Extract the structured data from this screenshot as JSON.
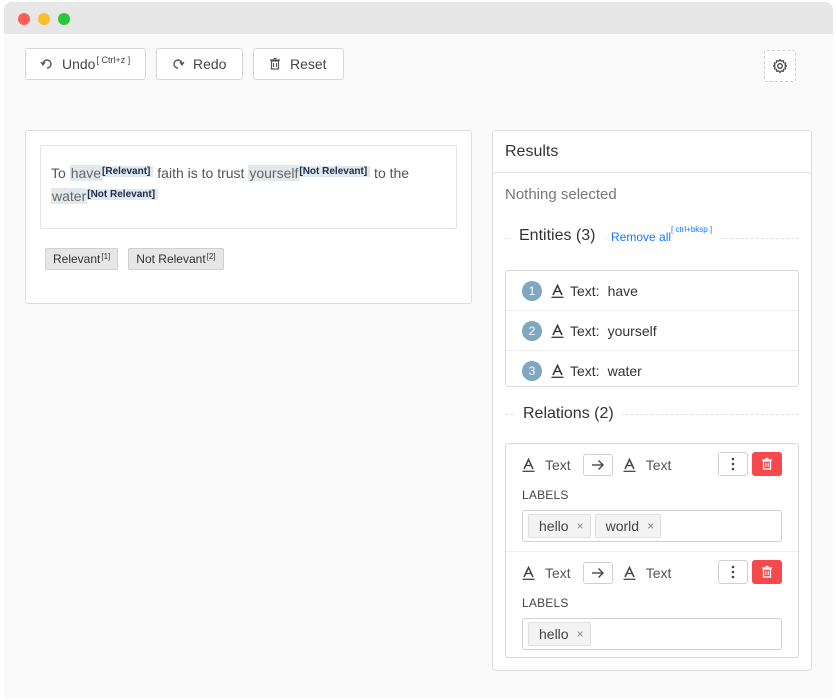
{
  "toolbar": {
    "undo_label": "Undo",
    "undo_shortcut": "[ Ctrl+z ]",
    "redo_label": "Redo",
    "reset_label": "Reset"
  },
  "editor": {
    "text_parts": {
      "t1": "To ",
      "e1": "have",
      "e1_tag": "[Relevant]",
      "t2": " faith is to trust ",
      "e2": "yourself",
      "e2_tag": "[Not Relevant]",
      "t3": " to the ",
      "e3": "water",
      "e3_tag": "[Not Relevant]"
    },
    "label_buttons": [
      {
        "label": "Relevant",
        "hotkey": "[1]"
      },
      {
        "label": "Not Relevant",
        "hotkey": "[2]"
      }
    ]
  },
  "results": {
    "title": "Results",
    "nothing_selected": "Nothing selected",
    "entities_title": "Entities (3)",
    "remove_all": "Remove all",
    "remove_all_shortcut": "[ ctrl+bksp ]",
    "entities": [
      {
        "num": "1",
        "kind": "Text:",
        "value": "have"
      },
      {
        "num": "2",
        "kind": "Text:",
        "value": "yourself"
      },
      {
        "num": "3",
        "kind": "Text:",
        "value": "water"
      }
    ],
    "relations_title": "Relations (2)",
    "relations": [
      {
        "from": "Text",
        "to": "Text",
        "labels_caption": "LABELS",
        "labels": [
          "hello",
          "world"
        ]
      },
      {
        "from": "Text",
        "to": "Text",
        "labels_caption": "LABELS",
        "labels": [
          "hello"
        ]
      }
    ]
  },
  "colors": {
    "accent_link": "#1677ff",
    "delete": "#f5494d",
    "badge": "#7ea8c0",
    "entity_highlight": "#e2e9ec"
  }
}
